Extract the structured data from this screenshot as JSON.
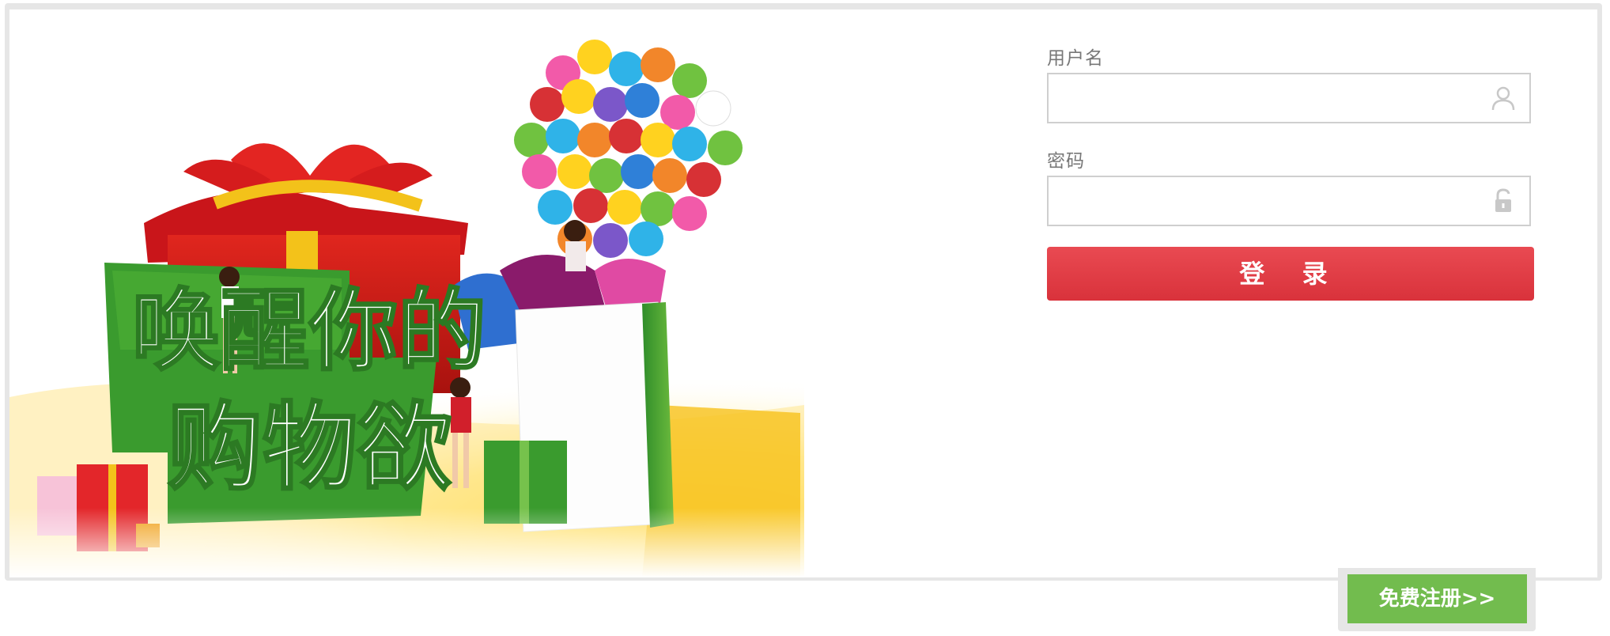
{
  "banner": {
    "headline_line1": "唤醒你的",
    "headline_line2": "购物欲",
    "image_description": "shopping promo banner"
  },
  "login": {
    "username_label": "用户名",
    "username_value": "",
    "password_label": "密码",
    "password_value": "",
    "submit_label": "登 录"
  },
  "register": {
    "label": "免费注册>>"
  },
  "icons": {
    "username_icon": "user-icon",
    "password_icon": "unlock-icon"
  },
  "colors": {
    "login_button": "#dd363f",
    "register_button": "#72bc4e",
    "frame": "#e6e6e6"
  }
}
